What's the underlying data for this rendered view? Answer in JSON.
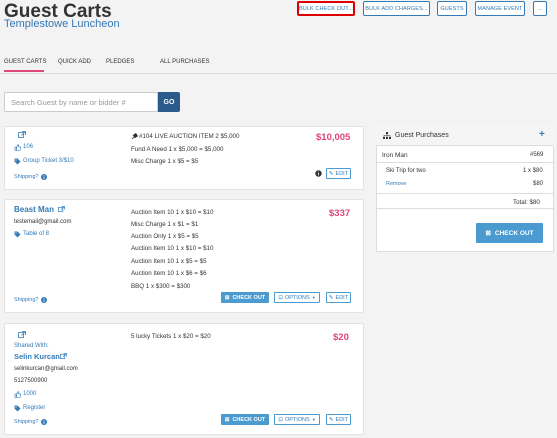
{
  "header": {
    "title": "Guest Carts",
    "subtitle": "Templestowe Luncheon",
    "buttons": {
      "bulk_checkout": "BULK CHECK OUT...",
      "bulk_add_charges": "BULK ADD CHARGES...",
      "guests": "GUESTS",
      "manage_event": "MANAGE EVENT",
      "more": "..."
    }
  },
  "tabs": [
    "GUEST CARTS",
    "QUICK ADD",
    "PLEDGES",
    "ALL PURCHASES"
  ],
  "search": {
    "placeholder": "Search Guest by name or bidder #",
    "button": "GO"
  },
  "cards": [
    {
      "bidder": "106",
      "tag": "Group Ticket 3/$10",
      "shipping": "Shipping?",
      "amount": "$10,005",
      "items": [
        {
          "name": "#104 LIVE AUCTION ITEM 2",
          "detail": "$5,000"
        },
        {
          "name": "Fund A Need",
          "detail": "1 x $5,000 = $5,000"
        },
        {
          "name": "Misc Charge",
          "detail": "1 x $5 = $5"
        }
      ],
      "edit": "EDIT"
    },
    {
      "name": "Beast Man",
      "email": "testemail@gmail.com",
      "tag": "Table of 8",
      "shipping": "Shipping?",
      "amount": "$337",
      "items": [
        {
          "name": "Auction Item 10",
          "detail": "1 x $10 = $10"
        },
        {
          "name": "Misc Charge",
          "detail": "1 x $1 = $1"
        },
        {
          "name": "Auction Only",
          "detail": "1 x $5 = $5"
        },
        {
          "name": "Auction Item 10",
          "detail": "1 x $10 = $10"
        },
        {
          "name": "Auction Item 10",
          "detail": "1 x $5 = $5"
        },
        {
          "name": "Auction Item 10",
          "detail": "1 x $6 = $6"
        },
        {
          "name": "BBQ",
          "detail": "1 x $300 = $300"
        }
      ],
      "checkout": "CHECK OUT",
      "options": "OPTIONS",
      "edit": "EDIT"
    },
    {
      "shared_with": "Shared With:",
      "name": "Selin Kurcan",
      "email": "selinkurcan@gmail.com",
      "phone": "5127500900",
      "bidder": "1000",
      "tag": "Register",
      "shipping": "Shipping?",
      "amount": "$20",
      "items": [
        {
          "name": "5 lucky Tickets",
          "detail": "1 x $20 = $20"
        }
      ],
      "checkout": "CHECK OUT",
      "options": "OPTIONS",
      "edit": "EDIT"
    }
  ],
  "purchases": {
    "title": "Guest Purchases",
    "add": "+",
    "guest_name": "Iron Man",
    "guest_number": "#569",
    "item_name": "Ski Trip for two",
    "item_qty": "1 x $80",
    "remove": "Remove",
    "item_total": "$80",
    "total": "Total: $80",
    "checkout": "CHECK OUT"
  }
}
